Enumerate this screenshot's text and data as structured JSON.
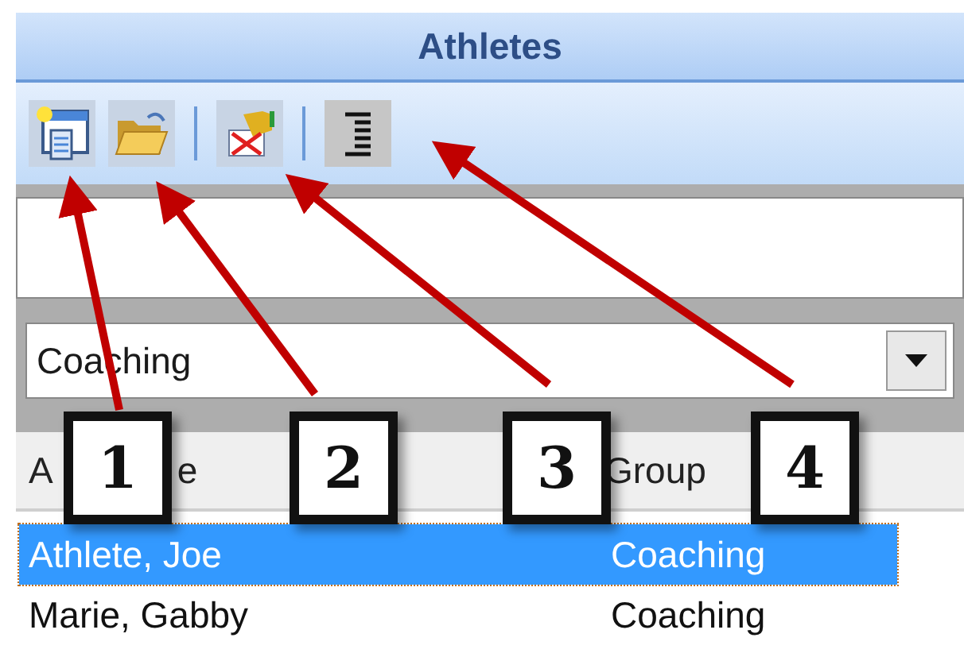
{
  "panel": {
    "title": "Athletes"
  },
  "group_filter": {
    "value": "Coaching"
  },
  "list": {
    "columns": [
      [
        "A",
        "e"
      ],
      [
        "Group"
      ]
    ],
    "rows": [
      {
        "athlete": "Athlete, Joe",
        "group": "Coaching",
        "selected": true
      },
      {
        "athlete": "Marie, Gabby",
        "group": "Coaching",
        "selected": false
      }
    ]
  },
  "callouts": [
    {
      "label": "1"
    },
    {
      "label": "2"
    },
    {
      "label": "3"
    },
    {
      "label": "4"
    }
  ]
}
